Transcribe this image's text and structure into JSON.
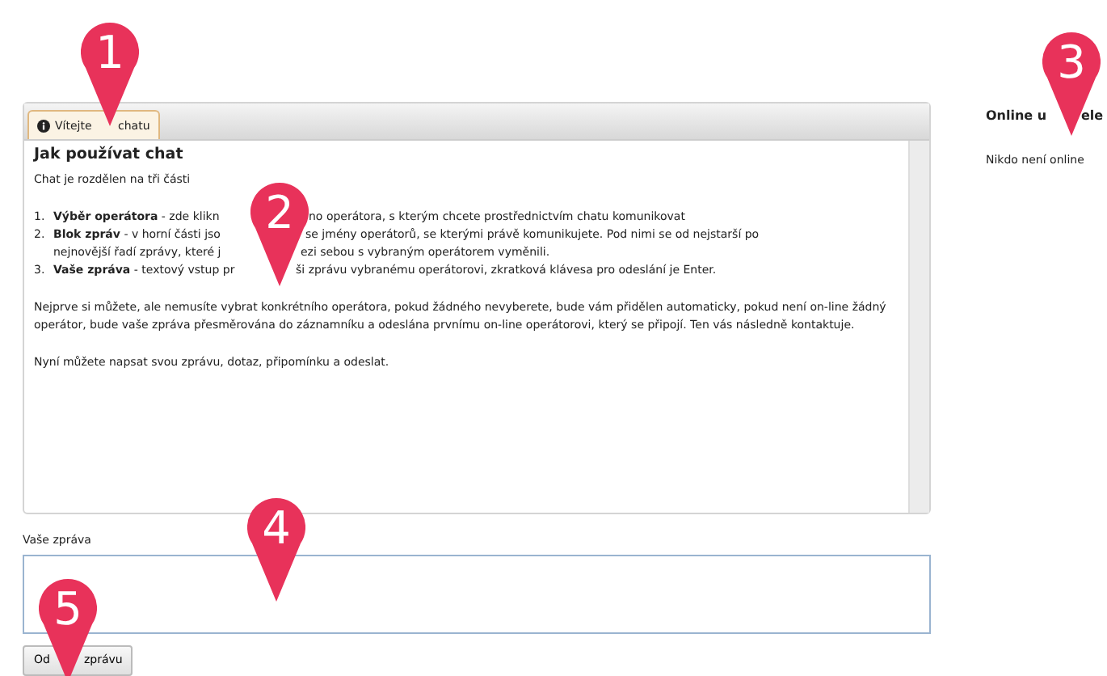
{
  "chat_panel": {
    "tab": {
      "label_parts": [
        "Vítejte",
        "chatu"
      ],
      "selected": true
    },
    "heading": "Jak používat chat",
    "intro": "Chat je rozdělen na tři části",
    "steps": [
      {
        "number": "1.",
        "lines": [
          [
            "**Výběr operátora** - zde klikn",
            "no operátora, s kterým chcete prostřednictvím chatu komunikovat"
          ]
        ]
      },
      {
        "number": "2.",
        "lines": [
          [
            "**Blok zpráv** - v horní části jso",
            "se jmény operátorů, se kterými právě komunikujete. Pod nimi se od nejstarší po"
          ],
          [
            "nejnovější řadí zprávy, které j",
            "ezi sebou s vybraným operátorem vyměnili."
          ]
        ]
      },
      {
        "number": "3.",
        "lines": [
          [
            "**Vaše zpráva** - textový vstup pr",
            "ši zprávu vybranému operátorovi, zkratková klávesa pro odeslání je Enter."
          ]
        ]
      }
    ],
    "paragraphs": [
      "Nejprve si můžete, ale nemusíte vybrat konkrétního operátora, pokud žádného nevyberete, bude vám přidělen automaticky, pokud není on-line žádný operátor, bude vaše zpráva přesměrována do záznamníku a odeslána prvnímu on-line operátorovi, který se připojí. Ten vás následně kontaktuje.",
      "Nyní můžete napsat svou zprávu, dotaz, připomínku a odeslat."
    ]
  },
  "message": {
    "label": "Vaše zpráva",
    "button_parts": [
      "Od",
      "zprávu"
    ]
  },
  "sidebar": {
    "title_parts": [
      "Online u",
      "ele"
    ],
    "status": "Nikdo není online"
  },
  "markers": [
    {
      "label": "1"
    },
    {
      "label": "2"
    },
    {
      "label": "3"
    },
    {
      "label": "4"
    },
    {
      "label": "5"
    }
  ]
}
